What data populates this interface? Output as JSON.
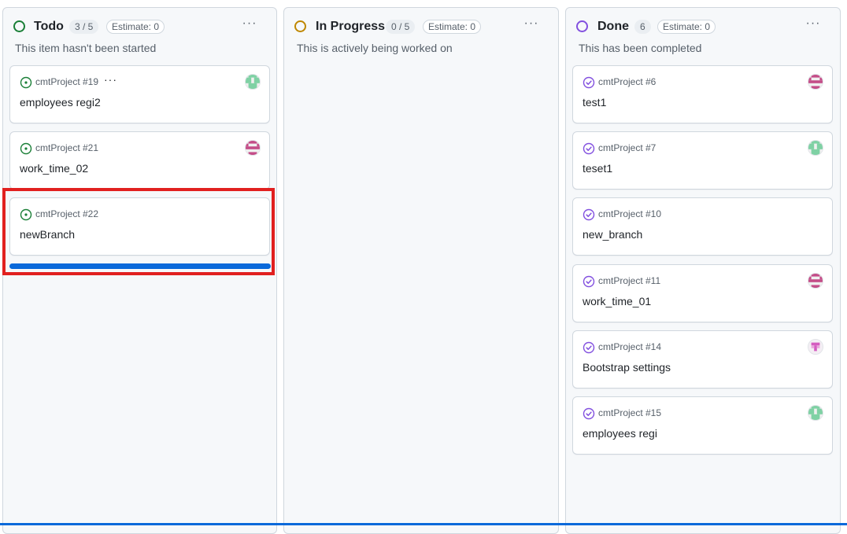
{
  "columns": [
    {
      "id": "todo",
      "title": "Todo",
      "count": "3 / 5",
      "estimate": "Estimate: 0",
      "description": "This item hasn't been started",
      "status_color": "#1a7f37",
      "cards": [
        {
          "repo": "cmtProject #19",
          "title": "employees regi2",
          "icon": "issue-open-icon",
          "avatar": "green-avatar",
          "has_more": true
        },
        {
          "repo": "cmtProject #21",
          "title": "work_time_02",
          "icon": "issue-open-icon",
          "avatar": "pink-avatar"
        },
        {
          "repo": "cmtProject #22",
          "title": "newBranch",
          "icon": "issue-open-icon",
          "avatar": null
        }
      ]
    },
    {
      "id": "in-progress",
      "title": "In Progress",
      "count": "0 / 5",
      "estimate": "Estimate: 0",
      "description": "This is actively being worked on",
      "status_color": "#bf8700",
      "cards": []
    },
    {
      "id": "done",
      "title": "Done",
      "count": "6",
      "estimate": "Estimate: 0",
      "description": "This has been completed",
      "status_color": "#8250df",
      "cards": [
        {
          "repo": "cmtProject #6",
          "title": "test1",
          "icon": "issue-closed-icon",
          "avatar": "pink-avatar"
        },
        {
          "repo": "cmtProject #7",
          "title": "teset1",
          "icon": "issue-closed-icon",
          "avatar": "green-avatar"
        },
        {
          "repo": "cmtProject #10",
          "title": "new_branch",
          "icon": "issue-closed-icon",
          "avatar": null
        },
        {
          "repo": "cmtProject #11",
          "title": "work_time_01",
          "icon": "issue-closed-icon",
          "avatar": "pink-avatar"
        },
        {
          "repo": "cmtProject #14",
          "title": "Bootstrap settings",
          "icon": "issue-closed-icon",
          "avatar": "magenta-avatar"
        },
        {
          "repo": "cmtProject #15",
          "title": "employees regi",
          "icon": "issue-closed-icon",
          "avatar": "green-avatar"
        }
      ]
    }
  ],
  "more_label": "···",
  "card_more_label": "···",
  "colors": {
    "accent_blue": "#0969da",
    "highlight_red": "#e1201f",
    "open_green": "#1a7f37",
    "done_purple": "#8250df"
  }
}
